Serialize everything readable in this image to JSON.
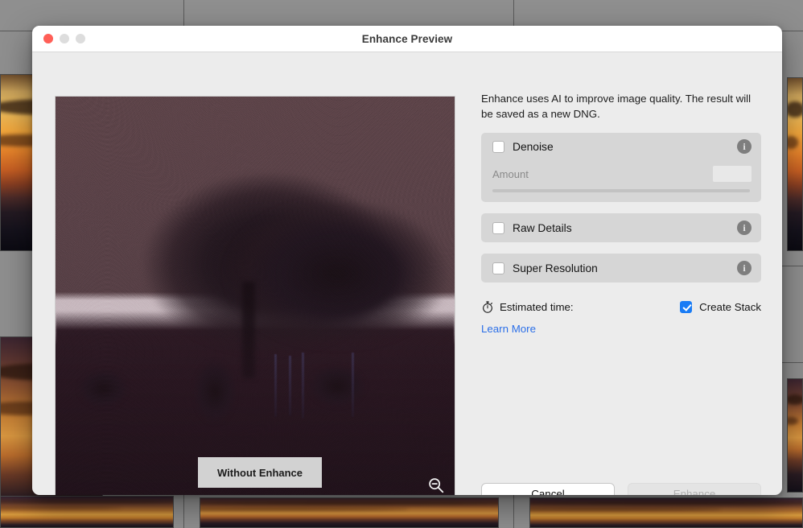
{
  "window": {
    "title": "Enhance Preview",
    "traffic_lights": [
      {
        "name": "close",
        "color": "#ff5f57"
      },
      {
        "name": "minimize",
        "color": "#dddddd"
      },
      {
        "name": "zoom",
        "color": "#dddddd"
      }
    ]
  },
  "preview": {
    "badge_label": "Without Enhance",
    "zoom_icon": "zoom-out-icon",
    "photo_description": "Noisy low-light photo of a tree silhouette over water at dusk"
  },
  "panel": {
    "description": "Enhance uses AI to improve image quality. The result will be saved as a new DNG.",
    "sections": [
      {
        "id": "denoise",
        "label": "Denoise",
        "checked": false,
        "info_icon": "info-icon",
        "amount_label": "Amount",
        "amount_value": "",
        "has_slider": true
      },
      {
        "id": "raw-details",
        "label": "Raw Details",
        "checked": false,
        "info_icon": "info-icon",
        "has_slider": false
      },
      {
        "id": "super-resolution",
        "label": "Super Resolution",
        "checked": false,
        "info_icon": "info-icon",
        "has_slider": false
      }
    ],
    "estimated_time_label": "Estimated time:",
    "estimated_time_value": "",
    "estimated_time_icon": "stopwatch-icon",
    "create_stack_label": "Create Stack",
    "create_stack_checked": true,
    "learn_more_label": "Learn More",
    "learn_more_color": "#2b6fe8"
  },
  "footer": {
    "cancel_label": "Cancel",
    "enhance_label": "Enhance",
    "enhance_enabled": false
  },
  "colors": {
    "accent_blue": "#1a7cf5",
    "link_blue": "#2b6fe8",
    "panel_bg": "#ececec",
    "section_bg": "#d6d6d6",
    "titlebar_bg": "#ffffff",
    "backdrop_gray": "#8f8f8f"
  }
}
